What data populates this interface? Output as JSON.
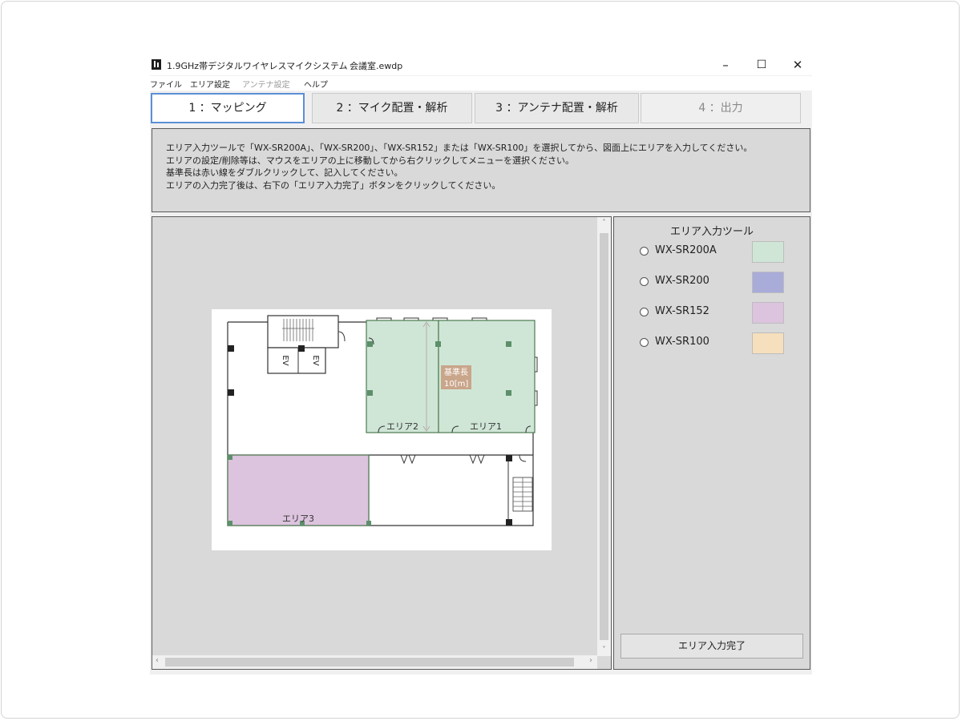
{
  "window": {
    "title": "1.9GHz帯デジタルワイヤレスマイクシステム",
    "file_name": "会議室.ewdp",
    "controls": {
      "minimize": "–",
      "maximize": "☐",
      "close": "✕"
    }
  },
  "menu": [
    {
      "label": "ファイル",
      "enabled": true
    },
    {
      "label": "エリア設定",
      "enabled": true
    },
    {
      "label": "アンテナ設定",
      "enabled": false
    },
    {
      "label": "ヘルプ",
      "enabled": true
    }
  ],
  "tabs": [
    {
      "label": "1 ：マッピング",
      "state": "active"
    },
    {
      "label": "2 ：マイク配置・解析",
      "state": "normal"
    },
    {
      "label": "3 ：アンテナ配置・解析",
      "state": "normal"
    },
    {
      "label": "4 ：出力",
      "state": "disabled"
    }
  ],
  "instructions": [
    "エリア入力ツールで「WX-SR200A」、「WX-SR200」、「WX-SR152」または「WX-SR100」を選択してから、図面上にエリアを入力してください。",
    "エリアの設定/削除等は、マウスをエリアの上に移動してから右クリックしてメニューを選択ください。",
    "基準長は赤い線をダブルクリックして、記入してください。",
    "エリアの入力完了後は、右下の「エリア入力完了」ボタンをクリックしてください。"
  ],
  "floorplan": {
    "ev_label": "EV",
    "reference": {
      "line1": "基準長",
      "line2": "10[m]"
    },
    "areas": [
      {
        "label": "エリア1",
        "model": "WX-SR200A"
      },
      {
        "label": "エリア2",
        "model": "WX-SR200A"
      },
      {
        "label": "エリア3",
        "model": "WX-SR152"
      }
    ]
  },
  "tool_panel": {
    "title": "エリア入力ツール",
    "options": [
      {
        "label": "WX-SR200A",
        "color": "#cfe6d7",
        "selected": false
      },
      {
        "label": "WX-SR200",
        "color": "#a9abd9",
        "selected": false
      },
      {
        "label": "WX-SR152",
        "color": "#dcc3de",
        "selected": false
      },
      {
        "label": "WX-SR100",
        "color": "#f6dfbd",
        "selected": false
      }
    ],
    "complete_button": "エリア入力完了"
  },
  "scroll_glyphs": {
    "up": "˄",
    "down": "˅",
    "left": "‹",
    "right": "›"
  }
}
